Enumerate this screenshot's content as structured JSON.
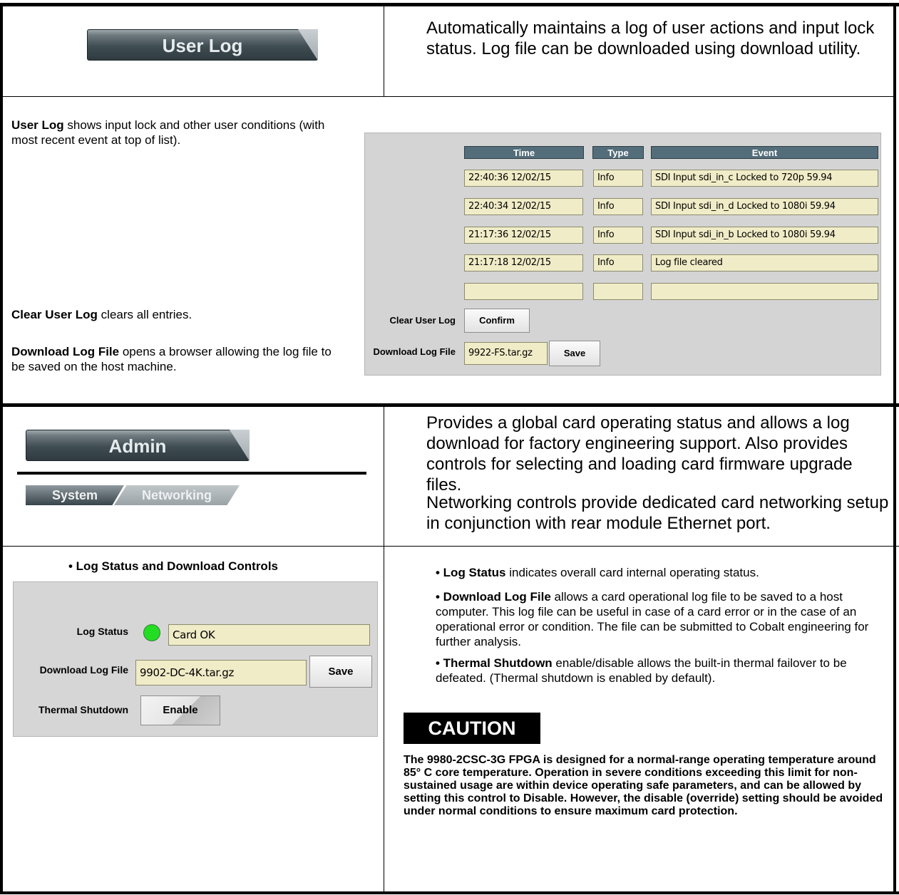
{
  "userlog": {
    "tab_label": "User Log",
    "summary": "Automatically maintains a log of user actions and input lock status. Log file can be downloaded using download utility.",
    "desc1_bold": "User Log",
    "desc1_rest": " shows input lock and other user conditions (with most recent event at top of list).",
    "desc2_bold": "Clear User Log",
    "desc2_rest": " clears all entries.",
    "desc3_bold": "Download Log File",
    "desc3_rest": " opens a browser allowing the log file to be saved on the host machine.",
    "headers": [
      "Time",
      "Type",
      "Event"
    ],
    "rows": [
      {
        "time": "22:40:36 12/02/15",
        "type": "Info",
        "event": "SDI Input sdi_in_c Locked to 720p 59.94"
      },
      {
        "time": "22:40:34 12/02/15",
        "type": "Info",
        "event": "SDI Input sdi_in_d Locked to 1080i 59.94"
      },
      {
        "time": "21:17:36 12/02/15",
        "type": "Info",
        "event": "SDI Input sdi_in_b Locked to 1080i 59.94"
      },
      {
        "time": "21:17:18 12/02/15",
        "type": "Info",
        "event": "Log file cleared"
      },
      {
        "time": "",
        "type": "",
        "event": ""
      }
    ],
    "clear_label": "Clear User Log",
    "confirm_label": "Confirm",
    "download_label": "Download Log File",
    "download_value": "9922-FS.tar.gz",
    "save_label": "Save"
  },
  "admin": {
    "tab_label": "Admin",
    "subtab_system": "System",
    "subtab_networking": "Networking",
    "summary1": "Provides a global card operating status and allows a log download for factory engineering support. Also provides controls for selecting and loading card firmware upgrade files.",
    "summary2": "Networking controls provide dedicated card networking setup in conjunction with rear module Ethernet port.",
    "section_title": "• Log Status and Download Controls",
    "log_status_label": "Log Status",
    "log_status_value": "Card OK",
    "status_color": "#22dd22",
    "download_label": "Download Log File",
    "download_value": "9902-DC-4K.tar.gz",
    "save_label": "Save",
    "thermal_label": "Thermal Shutdown",
    "thermal_button": "Enable",
    "bullet1_bold": "• Log Status",
    "bullet1_rest": " indicates overall card internal operating status.",
    "bullet2_bold": "• Download Log File",
    "bullet2_rest": " allows a card operational log file to be saved to a host computer. This log file can be useful in case of a card error or in the case of an operational error or condition. The file can be submitted to Cobalt engineering for further analysis.",
    "bullet3_bold": "• Thermal Shutdown",
    "bullet3_rest": " enable/disable allows the built-in thermal failover to be defeated. (Thermal shutdown is enabled by default).",
    "caution_title": "CAUTION",
    "caution_text": "The 9980-2CSC-3G FPGA is designed for a normal-range operating temperature around 85° C core temperature. Operation in severe conditions exceeding this limit for non-sustained usage are within device operating safe parameters, and can be allowed by setting this control to Disable. However, the disable (override) setting should be avoided under normal conditions to ensure maximum card protection."
  }
}
